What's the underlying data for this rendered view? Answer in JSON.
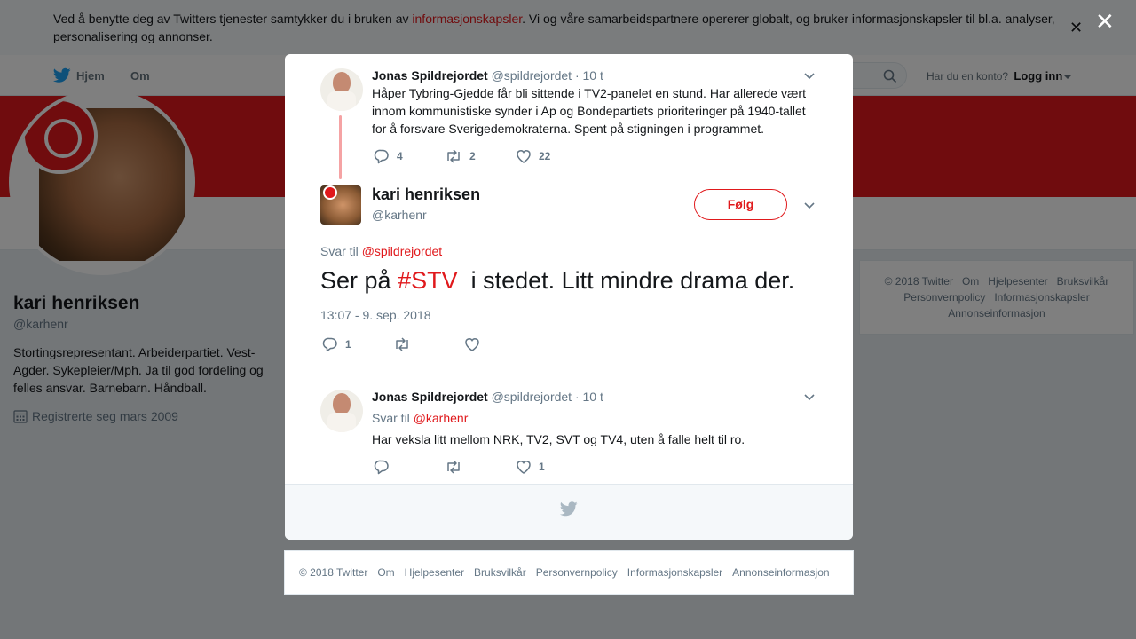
{
  "cookie_banner": {
    "text_before": "Ved å benytte deg av Twitters tjenester samtykker du i bruken av ",
    "link": "informasjonskapsler",
    "text_after": ". Vi og våre samarbeidspartnere opererer globalt, og bruker informasjonskapsler til bl.a. analyser, personalisering og annonser."
  },
  "nav": {
    "home": "Hjem",
    "about": "Om",
    "account_question": "Har du en konto?",
    "login": "Logg inn"
  },
  "profile": {
    "name": "kari henriksen",
    "handle": "@karhenr",
    "bio": "Stortingsrepresentant. Arbeiderpartiet. Vest-Agder. Sykepleier/Mph. Ja til god fordeling og felles ansvar. Barnebarn. Håndball.",
    "joined": "Registrerte seg mars 2009"
  },
  "side_footer": [
    "© 2018 Twitter",
    "Om",
    "Hjelpesenter",
    "Bruksvilkår",
    "Personvernpolicy",
    "Informasjonskapsler",
    "Annonseinformasjon"
  ],
  "modal": {
    "parent_tweet": {
      "name": "Jonas Spildrejordet",
      "handle": "@spildrejordet",
      "time": "· 10 t",
      "text": "Håper Tybring-Gjedde får bli sittende i TV2-panelet en stund. Har allerede vært innom kommunistiske synder i Ap og Bondepartiets prioriteringer på 1940-tallet for å forsvare Sverigedemokraterna. Spent på stigningen i programmet.",
      "replies": "4",
      "retweets": "2",
      "likes": "22"
    },
    "main_tweet": {
      "name": "kari henriksen",
      "handle": "@karhenr",
      "follow": "Følg",
      "reply_label": "Svar til",
      "reply_mention": "@spildrejordet",
      "text_before": "Ser på ",
      "hashtag": "#STV",
      "text_after": "  i stedet. Litt mindre drama der.",
      "timestamp": "13:07 - 9. sep. 2018",
      "replies": "1",
      "retweets": "",
      "likes": ""
    },
    "reply_tweet": {
      "name": "Jonas Spildrejordet",
      "handle": "@spildrejordet",
      "time": "· 10 t",
      "reply_label": "Svar til",
      "reply_mention": "@karhenr",
      "text": "Har veksla litt mellom NRK, TV2, SVT og TV4, uten å falle helt til ro.",
      "replies": "",
      "retweets": "",
      "likes": "1"
    }
  },
  "bottom_footer": [
    "© 2018 Twitter",
    "Om",
    "Hjelpesenter",
    "Bruksvilkår",
    "Personvernpolicy",
    "Informasjonskapsler",
    "Annonseinformasjon"
  ],
  "colors": {
    "accent": "#e0191c",
    "muted": "#657786",
    "text": "#14171a"
  }
}
